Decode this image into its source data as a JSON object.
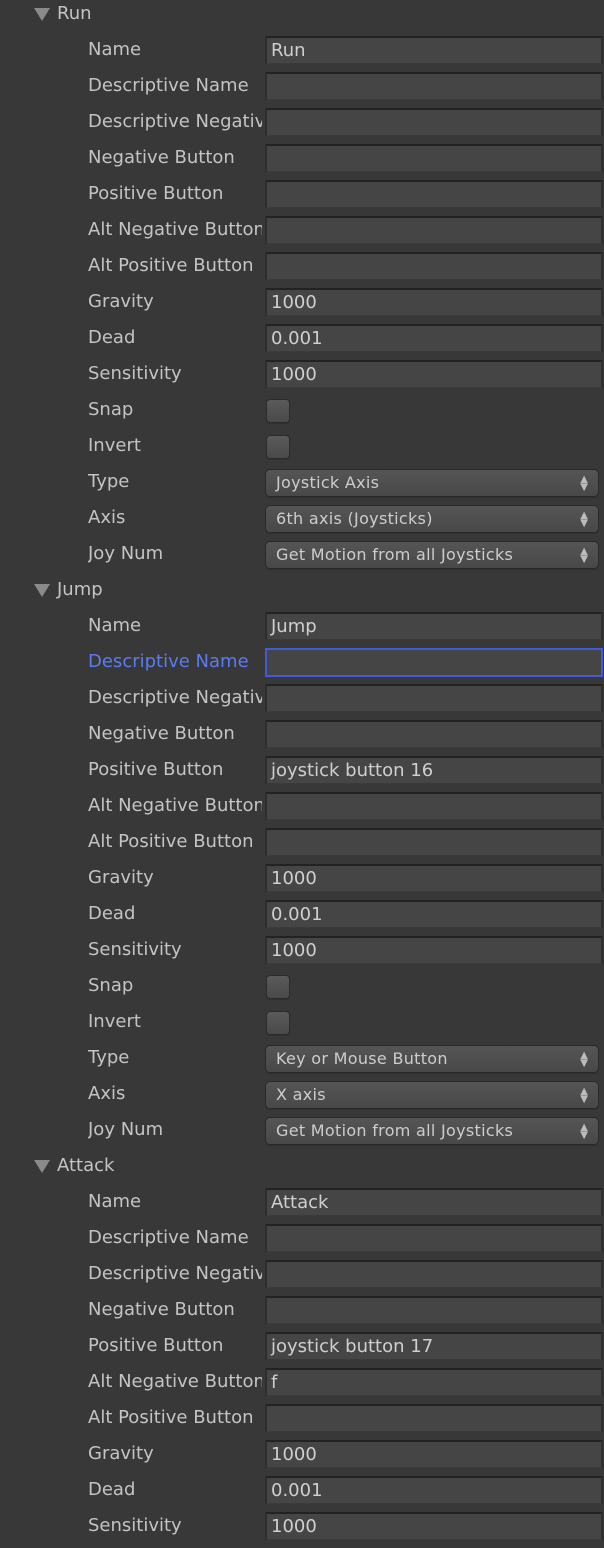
{
  "colors": {
    "background": "#383838",
    "field": "#454545",
    "text": "#c4c4c4",
    "focus": "#3f5bd8",
    "focus_label": "#5a7cf0"
  },
  "axes": [
    {
      "title": "Run",
      "fields": [
        {
          "label": "Name",
          "kind": "text",
          "value": "Run"
        },
        {
          "label": "Descriptive Name",
          "kind": "text",
          "value": ""
        },
        {
          "label": "Descriptive Negative Name",
          "kind": "text",
          "value": ""
        },
        {
          "label": "Negative Button",
          "kind": "text",
          "value": ""
        },
        {
          "label": "Positive Button",
          "kind": "text",
          "value": ""
        },
        {
          "label": "Alt Negative Button",
          "kind": "text",
          "value": ""
        },
        {
          "label": "Alt Positive Button",
          "kind": "text",
          "value": ""
        },
        {
          "label": "Gravity",
          "kind": "text",
          "value": "1000"
        },
        {
          "label": "Dead",
          "kind": "text",
          "value": "0.001"
        },
        {
          "label": "Sensitivity",
          "kind": "text",
          "value": "1000"
        },
        {
          "label": "Snap",
          "kind": "checkbox",
          "checked": false
        },
        {
          "label": "Invert",
          "kind": "checkbox",
          "checked": false
        },
        {
          "label": "Type",
          "kind": "dropdown",
          "value": "Joystick Axis"
        },
        {
          "label": "Axis",
          "kind": "dropdown",
          "value": "6th axis (Joysticks)"
        },
        {
          "label": "Joy Num",
          "kind": "dropdown",
          "value": "Get Motion from all Joysticks"
        }
      ]
    },
    {
      "title": "Jump",
      "fields": [
        {
          "label": "Name",
          "kind": "text",
          "value": "Jump"
        },
        {
          "label": "Descriptive Name",
          "kind": "text",
          "value": "",
          "focused": true
        },
        {
          "label": "Descriptive Negative Name",
          "kind": "text",
          "value": ""
        },
        {
          "label": "Negative Button",
          "kind": "text",
          "value": ""
        },
        {
          "label": "Positive Button",
          "kind": "text",
          "value": "joystick button 16"
        },
        {
          "label": "Alt Negative Button",
          "kind": "text",
          "value": ""
        },
        {
          "label": "Alt Positive Button",
          "kind": "text",
          "value": ""
        },
        {
          "label": "Gravity",
          "kind": "text",
          "value": "1000"
        },
        {
          "label": "Dead",
          "kind": "text",
          "value": "0.001"
        },
        {
          "label": "Sensitivity",
          "kind": "text",
          "value": "1000"
        },
        {
          "label": "Snap",
          "kind": "checkbox",
          "checked": false
        },
        {
          "label": "Invert",
          "kind": "checkbox",
          "checked": false
        },
        {
          "label": "Type",
          "kind": "dropdown",
          "value": "Key or Mouse Button"
        },
        {
          "label": "Axis",
          "kind": "dropdown",
          "value": "X axis"
        },
        {
          "label": "Joy Num",
          "kind": "dropdown",
          "value": "Get Motion from all Joysticks"
        }
      ]
    },
    {
      "title": "Attack",
      "fields": [
        {
          "label": "Name",
          "kind": "text",
          "value": "Attack"
        },
        {
          "label": "Descriptive Name",
          "kind": "text",
          "value": ""
        },
        {
          "label": "Descriptive Negative Name",
          "kind": "text",
          "value": ""
        },
        {
          "label": "Negative Button",
          "kind": "text",
          "value": ""
        },
        {
          "label": "Positive Button",
          "kind": "text",
          "value": "joystick button 17"
        },
        {
          "label": "Alt Negative Button",
          "kind": "text",
          "value": "f"
        },
        {
          "label": "Alt Positive Button",
          "kind": "text",
          "value": ""
        },
        {
          "label": "Gravity",
          "kind": "text",
          "value": "1000"
        },
        {
          "label": "Dead",
          "kind": "text",
          "value": "0.001"
        },
        {
          "label": "Sensitivity",
          "kind": "text",
          "value": "1000"
        }
      ]
    }
  ]
}
